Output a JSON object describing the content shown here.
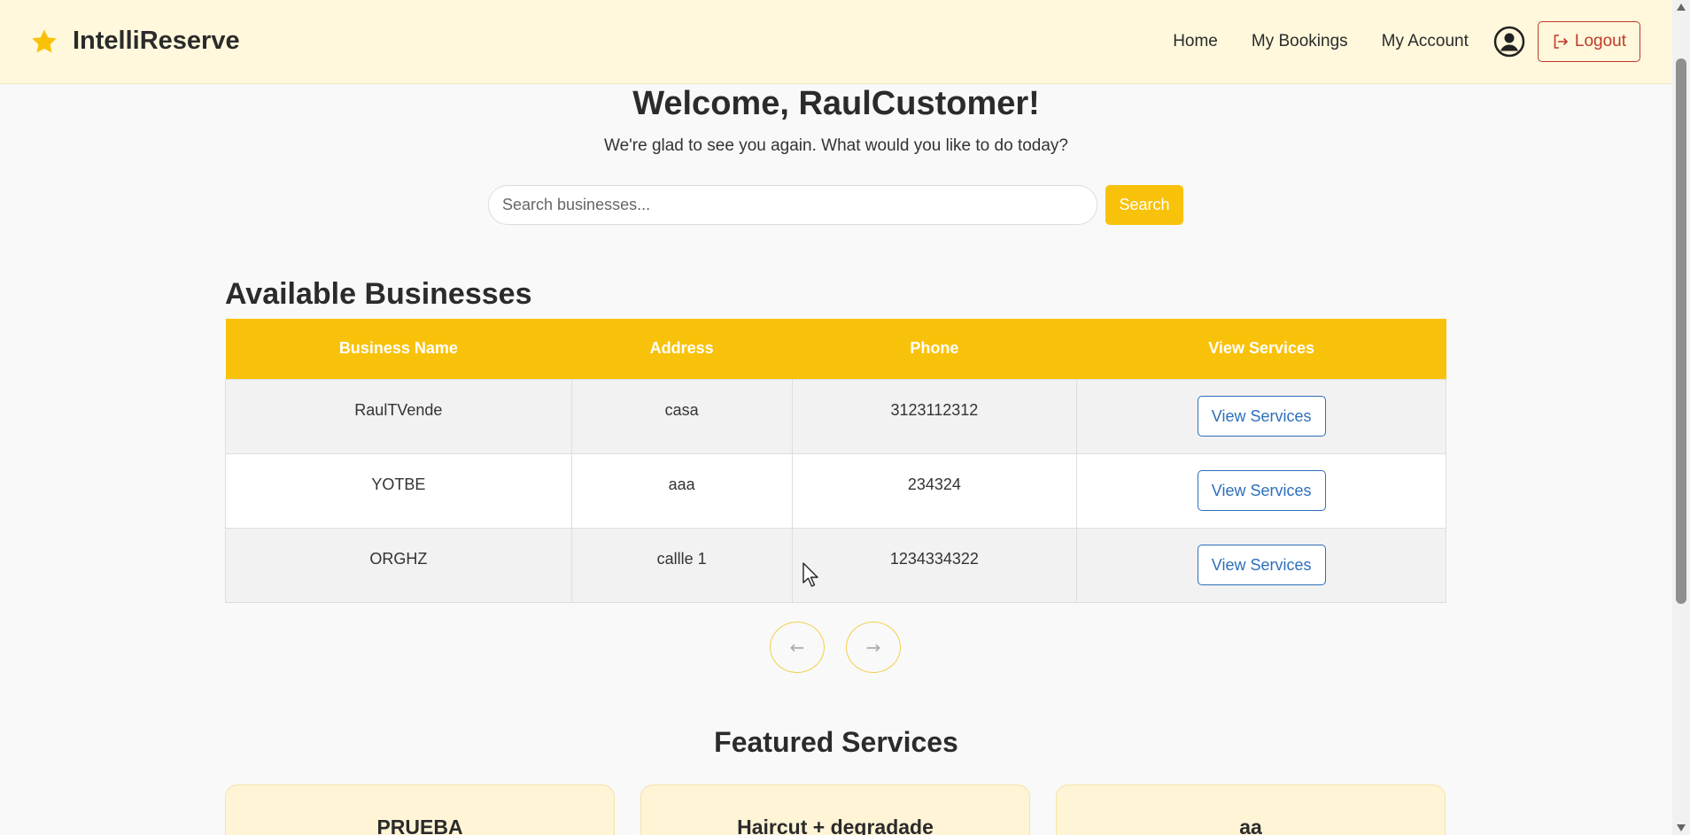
{
  "app": {
    "name": "IntelliReserve",
    "accent": "#f9c20a",
    "header_bg": "#fff8dc"
  },
  "nav": {
    "home": "Home",
    "bookings": "My Bookings",
    "account": "My Account",
    "logout": "Logout",
    "icons": {
      "brand": "star-icon",
      "account": "user-circle-icon",
      "logout": "logout-icon"
    }
  },
  "welcome": {
    "title": "Welcome, RaulCustomer!",
    "subtitle": "We're glad to see you again. What would you like to do today?"
  },
  "search": {
    "placeholder": "Search businesses...",
    "value": "",
    "button": "Search"
  },
  "businesses": {
    "title": "Available Businesses",
    "headers": [
      "Business Name",
      "Address",
      "Phone",
      "View Services"
    ],
    "rows": [
      {
        "name": "RaulTVende",
        "address": "casa",
        "phone": "3123112312",
        "action": "View Services"
      },
      {
        "name": "YOTBE",
        "address": "aaa",
        "phone": "234324",
        "action": "View Services"
      },
      {
        "name": "ORGHZ",
        "address": "callle 1",
        "phone": "1234334322",
        "action": "View Services"
      }
    ],
    "pagination": {
      "prev": "←",
      "next": "→"
    }
  },
  "featured": {
    "title": "Featured Services",
    "cards": [
      {
        "title": "PRUEBA"
      },
      {
        "title": "Haircut + degradade"
      },
      {
        "title": "aa"
      }
    ]
  }
}
